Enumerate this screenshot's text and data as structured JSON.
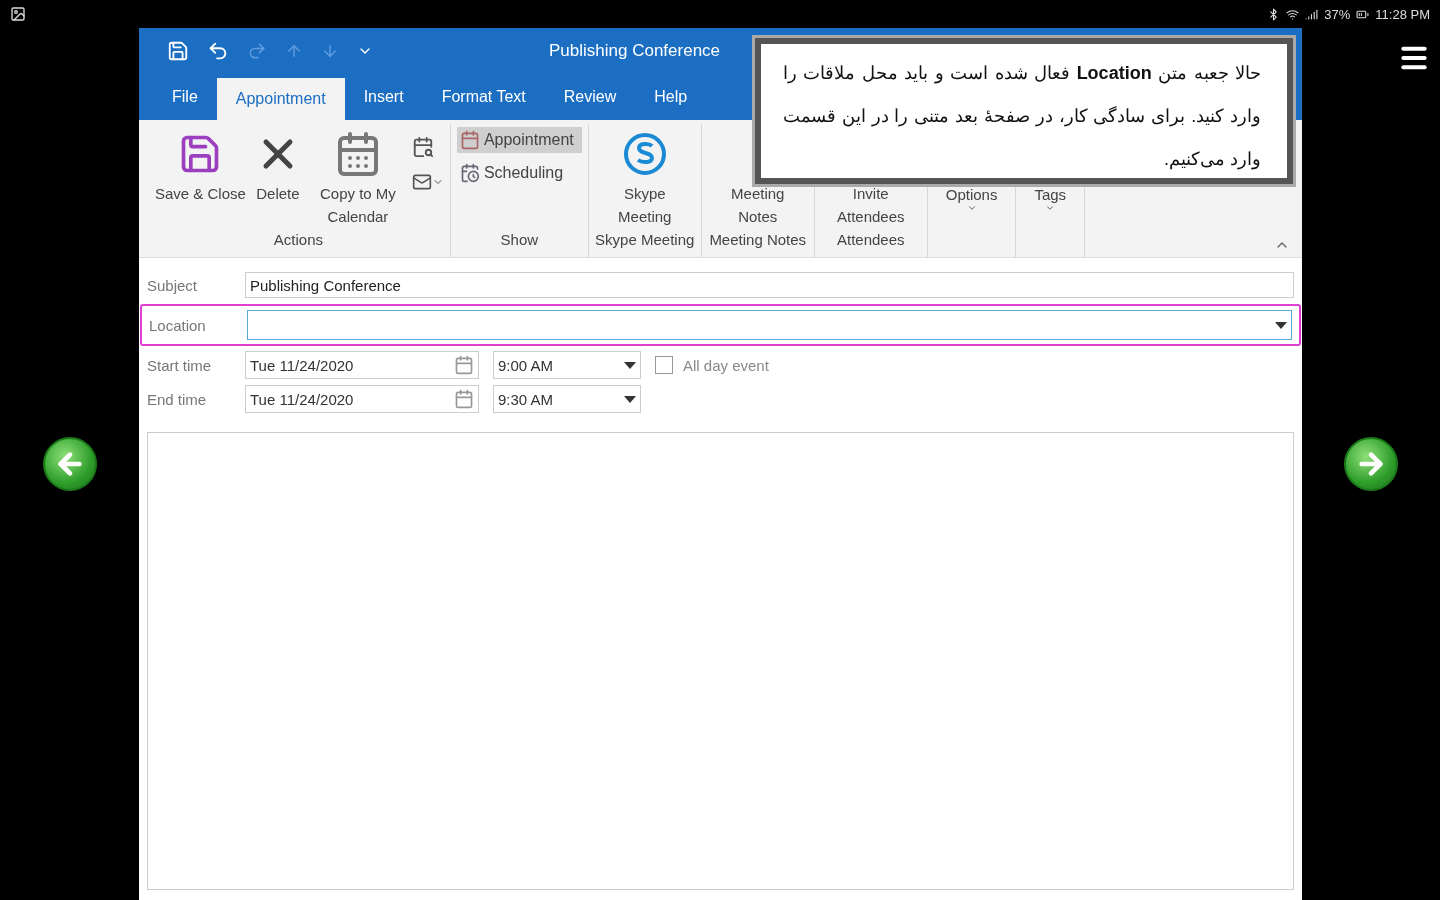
{
  "status_bar": {
    "battery": "37%",
    "time": "11:28 PM"
  },
  "window": {
    "title": "Publishing Conference"
  },
  "tabs": [
    {
      "label": "File",
      "selected": false
    },
    {
      "label": "Appointment",
      "selected": true
    },
    {
      "label": "Insert",
      "selected": false
    },
    {
      "label": "Format Text",
      "selected": false
    },
    {
      "label": "Review",
      "selected": false
    },
    {
      "label": "Help",
      "selected": false
    }
  ],
  "ribbon": {
    "groups": [
      {
        "label": "Actions",
        "buttons": [
          {
            "kind": "large",
            "label": "Save & Close"
          },
          {
            "kind": "large",
            "label": "Delete"
          },
          {
            "kind": "large",
            "label": "Copy to My Calendar"
          },
          {
            "kind": "small_stack"
          }
        ]
      },
      {
        "label": "Show",
        "buttons": [
          {
            "kind": "toggle",
            "label": "Appointment",
            "selected": true
          },
          {
            "kind": "toggle",
            "label": "Scheduling",
            "selected": false
          }
        ]
      },
      {
        "label": "Skype Meeting",
        "buttons": [
          {
            "kind": "large",
            "label": "Skype Meeting"
          }
        ]
      },
      {
        "label": "Meeting Notes",
        "buttons": [
          {
            "kind": "large",
            "label": "Meeting Notes"
          }
        ]
      },
      {
        "label": "Attendees",
        "buttons": [
          {
            "kind": "large",
            "label": "Invite Attendees"
          }
        ]
      },
      {
        "buttons": [
          {
            "kind": "menu",
            "label": "Options"
          }
        ]
      },
      {
        "buttons": [
          {
            "kind": "menu",
            "label": "Tags"
          }
        ]
      }
    ]
  },
  "form": {
    "subject": {
      "label": "Subject",
      "value": "Publishing Conference"
    },
    "location": {
      "label": "Location",
      "highlighted": true
    },
    "start": {
      "label": "Start time",
      "date": "Tue 11/24/2020",
      "time": "9:00 AM"
    },
    "end": {
      "label": "End time",
      "date": "Tue 11/24/2020",
      "time": "9:30 AM"
    },
    "all_day": {
      "label": "All day event",
      "checked": false
    }
  },
  "callout": {
    "text": "حالا جعبه متن **Location** فعال شده است و باید محل ملاقات را وارد کنید. برای سادگی کار، در صفحهٔ بعد متنی را در این قسمت وارد می‌کنیم."
  }
}
